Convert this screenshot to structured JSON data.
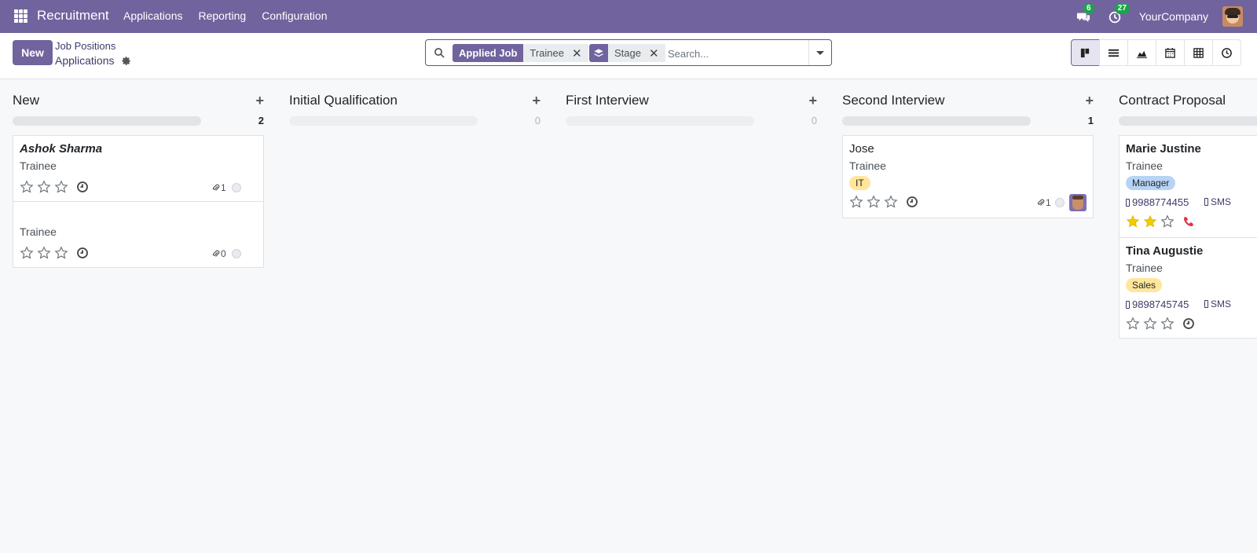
{
  "navbar": {
    "app_name": "Recruitment",
    "menu": [
      "Applications",
      "Reporting",
      "Configuration"
    ],
    "messages_badge": "6",
    "activities_badge": "27",
    "company": "YourCompany"
  },
  "control": {
    "new_label": "New",
    "breadcrumb_parent": "Job Positions",
    "breadcrumb_current": "Applications",
    "search": {
      "facet1_label": "Applied Job",
      "facet1_value": "Trainee",
      "facet2_value": "Stage",
      "placeholder": "Search..."
    },
    "active_view": "kanban"
  },
  "columns": [
    {
      "title": "New",
      "count": "2",
      "cards": [
        {
          "name": "Ashok Sharma",
          "job": "Trainee",
          "attachments": "1"
        },
        {
          "name": "",
          "job": "Trainee",
          "attachments": "0"
        }
      ]
    },
    {
      "title": "Initial Qualification",
      "count": "0",
      "cards": []
    },
    {
      "title": "First Interview",
      "count": "0",
      "cards": []
    },
    {
      "title": "Second Interview",
      "count": "1",
      "cards": [
        {
          "name": "Jose",
          "job": "Trainee",
          "tag": "IT",
          "attachments": "1"
        }
      ]
    },
    {
      "title": "Contract Proposal",
      "cards": [
        {
          "name": "Marie Justine",
          "job": "Trainee",
          "tag": "Manager",
          "phone": "9988774455",
          "sms": "SMS",
          "priority": 2
        },
        {
          "name": "Tina Augustie",
          "job": "Trainee",
          "tag": "Sales",
          "phone": "9898745745",
          "sms": "SMS",
          "priority": 0
        }
      ]
    }
  ],
  "colors": {
    "brand": "#71639e",
    "star_filled": "#f3cc00",
    "phone_red": "#dc3545"
  }
}
